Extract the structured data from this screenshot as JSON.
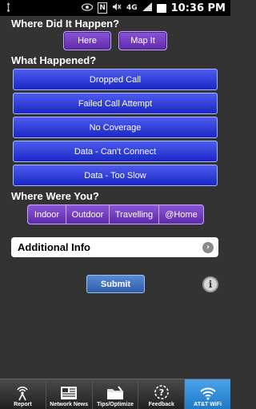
{
  "status_bar": {
    "time": "10:36 PM",
    "network_label": "4G",
    "nfc_label": "N"
  },
  "where_happened": {
    "title": "Where Did It Happen?",
    "here_label": "Here",
    "map_label": "Map It"
  },
  "what_happened": {
    "title": "What Happened?",
    "options": [
      {
        "label": "Dropped Call"
      },
      {
        "label": "Failed Call Attempt"
      },
      {
        "label": "No Coverage"
      },
      {
        "label": "Data - Can't Connect"
      },
      {
        "label": "Data - Too Slow"
      }
    ]
  },
  "where_were_you": {
    "title": "Where Were You?",
    "options": [
      {
        "label": "Indoor"
      },
      {
        "label": "Outdoor"
      },
      {
        "label": "Travelling"
      },
      {
        "label": "@Home"
      }
    ]
  },
  "additional_info": {
    "label": "Additional Info"
  },
  "submit_label": "Submit",
  "info_glyph": "i",
  "tabs": [
    {
      "label": "Report",
      "icon": "antenna-icon"
    },
    {
      "label": "Network News",
      "icon": "newspaper-icon"
    },
    {
      "label": "Tips/Optimize",
      "icon": "folder-icon"
    },
    {
      "label": "Feedback",
      "icon": "question-bubble-icon"
    },
    {
      "label": "AT&T WiFi",
      "icon": "wifi-icon"
    }
  ],
  "colors": {
    "background": "#333333",
    "purple_button": "#6a35b8",
    "blue_button": "#2a35d8",
    "active_tab": "#2e8bd6"
  }
}
